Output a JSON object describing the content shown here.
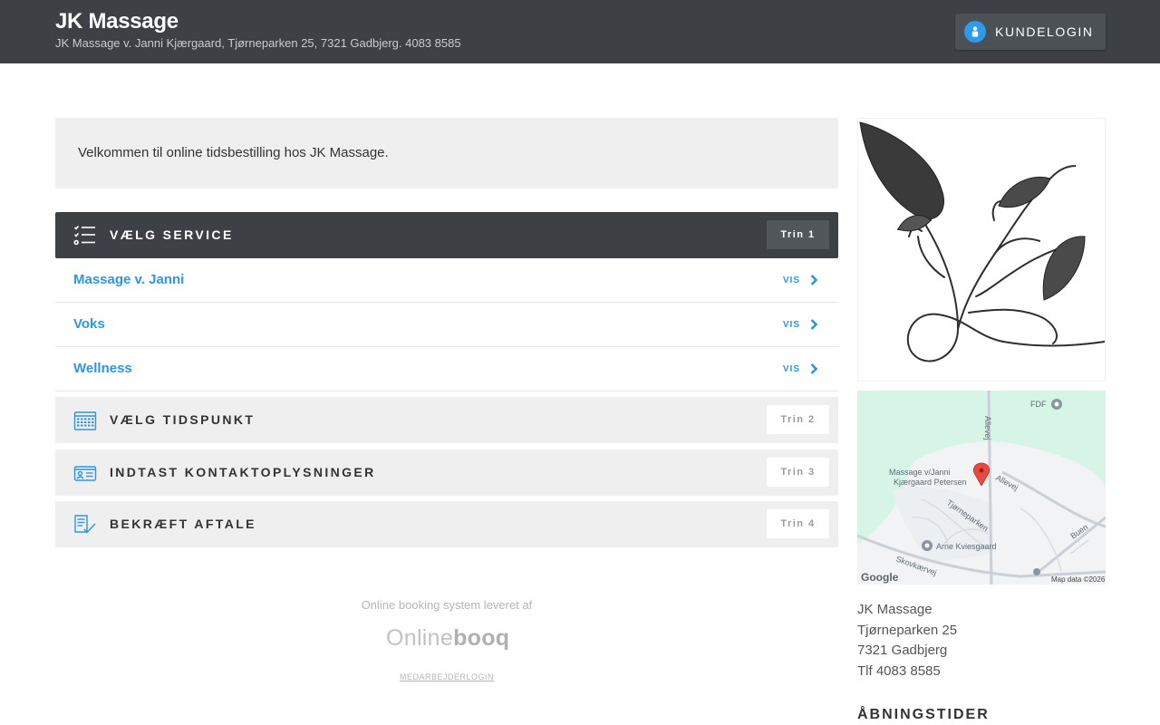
{
  "header": {
    "title": "JK Massage",
    "subtitle": "JK Massage v. Janni Kjærgaard, Tjørneparken 25, 7321 Gadbjerg. 4083 8585",
    "login_label": "Kundelogin",
    "login_icon": "user-icon"
  },
  "welcome": {
    "text": "Velkommen til online tidsbestilling hos JK Massage."
  },
  "steps": [
    {
      "title": "Vælg service",
      "badge": "Trin 1",
      "icon": "checklist-icon",
      "active": true
    },
    {
      "title": "Vælg tidspunkt",
      "badge": "Trin 2",
      "icon": "calendar-icon",
      "active": false
    },
    {
      "title": "Indtast kontaktoplysninger",
      "badge": "Trin 3",
      "icon": "contact-card-icon",
      "active": false
    },
    {
      "title": "Bekræft aftale",
      "badge": "Trin 4",
      "icon": "document-check-icon",
      "active": false
    }
  ],
  "services": [
    {
      "name": "Massage v. Janni",
      "action": "VIS"
    },
    {
      "name": "Voks",
      "action": "VIS"
    },
    {
      "name": "Wellness",
      "action": "VIS"
    }
  ],
  "footer": {
    "provided_by": "Online booking system leveret af",
    "logo_light": "Online",
    "logo_bold": "booq",
    "staff_login": "MEDARBEJDERLOGIN"
  },
  "map": {
    "labels": {
      "fdf": "FDF",
      "allevej": "Allevej",
      "allevej2": "Allevej",
      "place_line1": "Massage v/Janni",
      "place_line2": "Kjærgaard Petersen",
      "tjorneparken": "Tjørneparken",
      "arne": "Arne Kviesgaard",
      "skovkaervej": "Skovkærvej",
      "buen": "Buen",
      "google": "Google",
      "map_data": "Map data ©2026"
    }
  },
  "sidebar": {
    "address": {
      "name": "JK Massage",
      "street": "Tjørneparken 25",
      "city": "7321 Gadbjerg",
      "phone": "Tlf 4083 8585"
    },
    "hours_title": "Åbningstider"
  },
  "colors": {
    "header_bg": "#3d4145",
    "accent_blue": "#2d96e1",
    "step_bg": "#efefef"
  }
}
